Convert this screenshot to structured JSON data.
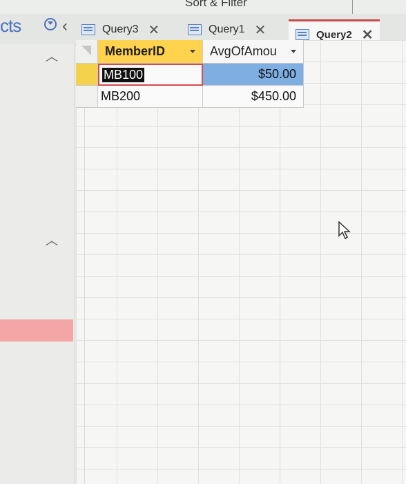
{
  "ribbon": {
    "group_label": "Sort & Filter"
  },
  "nav_pane": {
    "title": "cts"
  },
  "tabs": [
    {
      "label": "Query3",
      "active": false
    },
    {
      "label": "Query1",
      "active": false
    },
    {
      "label": "Query2",
      "active": true
    }
  ],
  "datasheet": {
    "columns": [
      "MemberID",
      "AvgOfAmou"
    ],
    "rows": [
      {
        "MemberID": "MB100",
        "AvgOfAmount": "$50.00"
      },
      {
        "MemberID": "MB200",
        "AvgOfAmount": "$450.00"
      }
    ]
  },
  "colors": {
    "accent_tab": "#c84b4b",
    "header_selected": "#ffd34d",
    "cell_highlight": "#7faee3",
    "nav_selected": "#f4a6a6"
  }
}
